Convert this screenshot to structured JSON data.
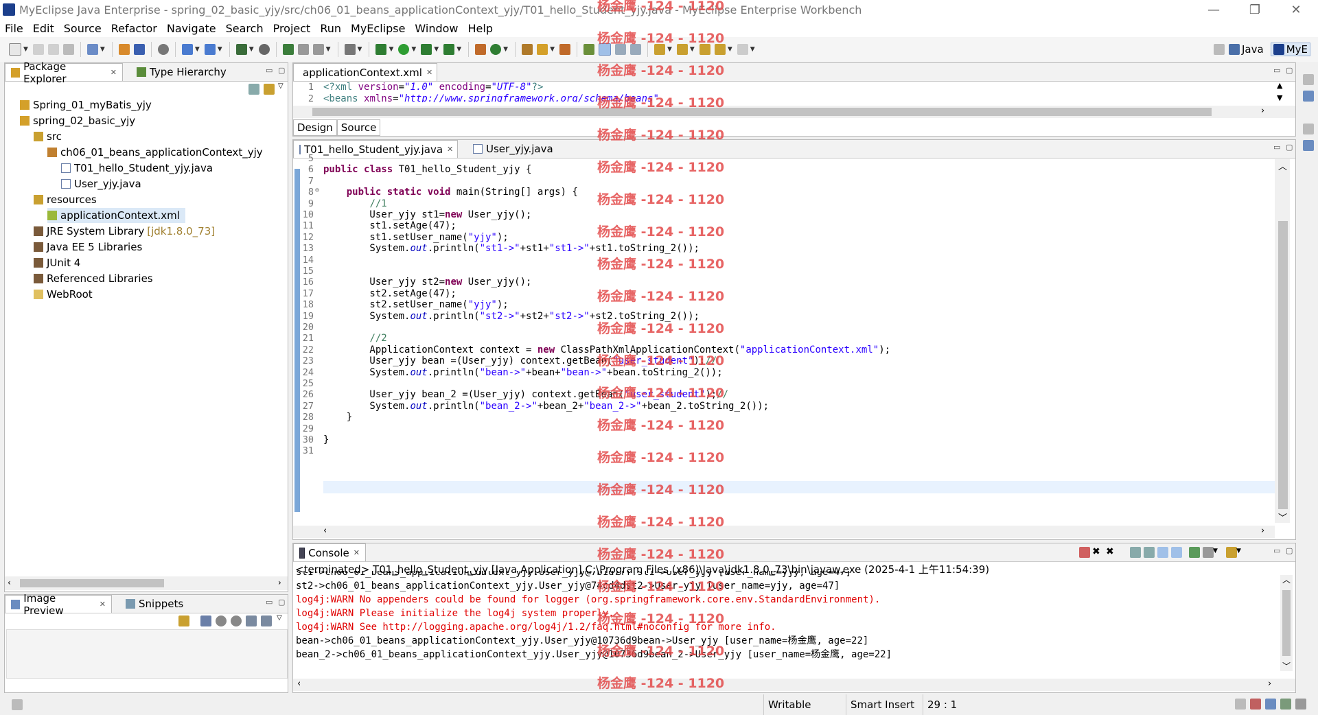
{
  "window": {
    "title": "MyEclipse Java Enterprise - spring_02_basic_yjy/src/ch06_01_beans_applicationContext_yjy/T01_hello_Student_yjy.java - MyEclipse Enterprise Workbench",
    "minimize": "—",
    "restore": "❐",
    "close": "✕"
  },
  "menu": [
    "File",
    "Edit",
    "Source",
    "Refactor",
    "Navigate",
    "Search",
    "Project",
    "Run",
    "MyEclipse",
    "Window",
    "Help"
  ],
  "perspectives": {
    "java": "Java",
    "myeclipse": "MyE"
  },
  "package_explorer": {
    "tabs": [
      "Package Explorer",
      "Type Hierarchy"
    ],
    "items": [
      {
        "label": "Spring_01_myBatis_yjy"
      },
      {
        "label": "spring_02_basic_yjy"
      },
      {
        "label": "src"
      },
      {
        "label": "ch06_01_beans_applicationContext_yjy"
      },
      {
        "label": "T01_hello_Student_yjy.java"
      },
      {
        "label": "User_yjy.java"
      },
      {
        "label": "resources"
      },
      {
        "label": "applicationContext.xml"
      },
      {
        "label": "JRE System Library",
        "decoration": "[jdk1.8.0_73]"
      },
      {
        "label": "Java EE 5 Libraries"
      },
      {
        "label": "JUnit 4"
      },
      {
        "label": "Referenced Libraries"
      },
      {
        "label": "WebRoot"
      }
    ]
  },
  "image_preview": {
    "tabs": [
      "Image Preview",
      "Snippets"
    ]
  },
  "xml_editor": {
    "tab": "applicationContext.xml",
    "lines": [
      {
        "n": "1",
        "tag": "<?xml ",
        "a1": "version",
        "eq1": "=",
        "v1": "\"1.0\"",
        "sp": " ",
        "a2": "encoding",
        "eq2": "=",
        "v2": "\"UTF-8\"",
        "end": "?>"
      },
      {
        "n": "2",
        "tag": "<beans ",
        "a1": "xmlns",
        "eq1": "=",
        "v1": "\"http://www.springframework.org/schema/beans\"",
        "sp": "",
        "a2": "",
        "eq2": "",
        "v2": "",
        "end": ""
      }
    ],
    "design_tab": "Design",
    "source_tab": "Source"
  },
  "java_editor": {
    "tabs": [
      "T01_hello_Student_yjy.java",
      "User_yjy.java"
    ],
    "lines": [
      {
        "n": "5",
        "t": ""
      },
      {
        "n": "6",
        "t": "public class T01_hello_Student_yjy {"
      },
      {
        "n": "7",
        "t": ""
      },
      {
        "n": "8",
        "t": "    public static void main(String[] args) {"
      },
      {
        "n": "9",
        "t": "        //1"
      },
      {
        "n": "10",
        "t": "        User_yjy st1=new User_yjy();"
      },
      {
        "n": "11",
        "t": "        st1.setAge(47);"
      },
      {
        "n": "12",
        "t": "        st1.setUser_name(\"yjy\");"
      },
      {
        "n": "13",
        "t": "        System.out.println(\"st1->\"+st1+\"st1->\"+st1.toString_2());"
      },
      {
        "n": "14",
        "t": ""
      },
      {
        "n": "15",
        "t": ""
      },
      {
        "n": "16",
        "t": "        User_yjy st2=new User_yjy();"
      },
      {
        "n": "17",
        "t": "        st2.setAge(47);"
      },
      {
        "n": "18",
        "t": "        st2.setUser_name(\"yjy\");"
      },
      {
        "n": "19",
        "t": "        System.out.println(\"st2->\"+st2+\"st2->\"+st2.toString_2());"
      },
      {
        "n": "20",
        "t": ""
      },
      {
        "n": "21",
        "t": "        //2"
      },
      {
        "n": "22",
        "t": "        ApplicationContext context = new ClassPathXmlApplicationContext(\"applicationContext.xml\");"
      },
      {
        "n": "23",
        "t": "        User_yjy bean =(User_yjy) context.getBean(\"user_student\");//"
      },
      {
        "n": "24",
        "t": "        System.out.println(\"bean->\"+bean+\"bean->\"+bean.toString_2());"
      },
      {
        "n": "25",
        "t": ""
      },
      {
        "n": "26",
        "t": "        User_yjy bean_2 =(User_yjy) context.getBean(\"user_student\");//"
      },
      {
        "n": "27",
        "t": "        System.out.println(\"bean_2->\"+bean_2+\"bean_2->\"+bean_2.toString_2());"
      },
      {
        "n": "28",
        "t": "    }"
      },
      {
        "n": "29",
        "t": ""
      },
      {
        "n": "30",
        "t": "}"
      },
      {
        "n": "31",
        "t": ""
      }
    ]
  },
  "console": {
    "tab": "Console",
    "header": "<terminated> T01_hello_Student_yjy [Java Application] C:\\Program Files (x86)\\Java\\jdk1.8.0_73\\bin\\javaw.exe (2025-4-1 上午11:54:39)",
    "lines": [
      {
        "t": "st1->ch06_01_beans_applicationContext_yjy.User_yjy@7b1d7fffst1->User_yjy [user_name=yjy, age=47]",
        "err": false
      },
      {
        "t": "st2->ch06_01_beans_applicationContext_yjy.User_yjy@74cd4dst2->User_yjy [user_name=yjy, age=47]",
        "err": false
      },
      {
        "t": "log4j:WARN No appenders could be found for logger (org.springframework.core.env.StandardEnvironment).",
        "err": true
      },
      {
        "t": "log4j:WARN Please initialize the log4j system properly.",
        "err": true
      },
      {
        "t": "log4j:WARN See http://logging.apache.org/log4j/1.2/faq.html#noconfig for more info.",
        "err": true
      },
      {
        "t": "bean->ch06_01_beans_applicationContext_yjy.User_yjy@10736d9bean->User_yjy [user_name=杨金鹰, age=22]",
        "err": false
      },
      {
        "t": "bean_2->ch06_01_beans_applicationContext_yjy.User_yjy@10736d9bean_2->User_yjy [user_name=杨金鹰, age=22]",
        "err": false
      }
    ]
  },
  "statusbar": {
    "writable": "Writable",
    "insert": "Smart Insert",
    "position": "29 : 1"
  },
  "watermark": "杨金鹰 -124 - 1120",
  "colors": {
    "keyword": "#7f0055",
    "string": "#2a00ff",
    "comment": "#3f7f5f",
    "field": "#0000c0",
    "error": "#e00000",
    "watermark": "#e34b4b",
    "selection": "#dbe9f7"
  }
}
